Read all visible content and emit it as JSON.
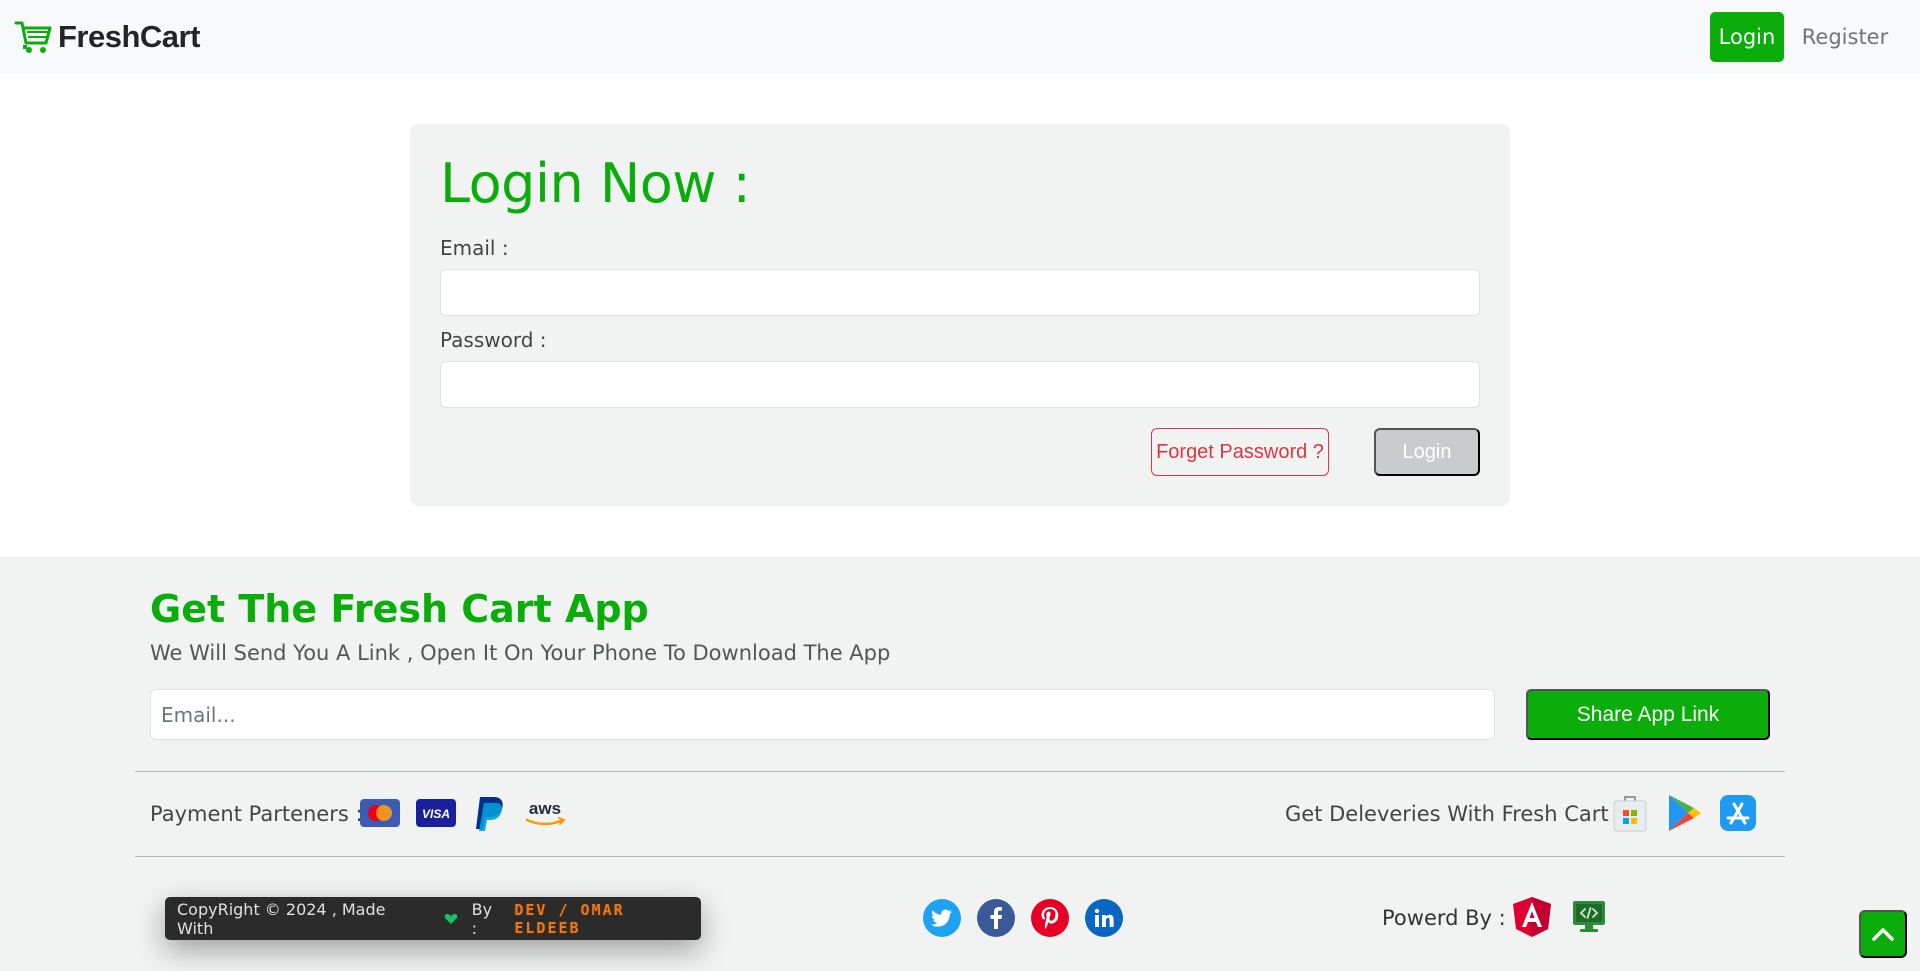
{
  "nav": {
    "brand": "FreshCart",
    "login": "Login",
    "register": "Register"
  },
  "login_form": {
    "title": "Login Now :",
    "email_label": "Email :",
    "password_label": "Password :",
    "email_value": "",
    "password_value": "",
    "forget_button": "Forget Password ?",
    "login_button": "Login"
  },
  "footer": {
    "title": "Get The Fresh Cart App",
    "subtitle": "We Will Send You A Link , Open It On Your Phone To Download The App",
    "email_placeholder": "Email...",
    "share_button": "Share App Link",
    "payment_label": "Payment Parteners :",
    "payment_icons": [
      "mastercard-icon",
      "visa-icon",
      "paypal-icon",
      "aws-icon"
    ],
    "delivery_label": "Get Deleveries With Fresh Cart :",
    "delivery_icons": [
      "microsoft-store-icon",
      "google-play-icon",
      "app-store-icon"
    ],
    "copyright": "CopyRight © 2024 , Made With",
    "by": "By :",
    "author": "DEV / OMAR ELDEEB",
    "social_icons": [
      "twitter-icon",
      "facebook-icon",
      "pinterest-icon",
      "linkedin-icon"
    ],
    "powered_label": "Powerd By :",
    "powered_icons": [
      "angular-icon",
      "code-monitor-icon"
    ]
  },
  "colors": {
    "brand_green": "#0aad0a",
    "danger": "#dc3545",
    "footer_bg": "#f0f3f2"
  }
}
